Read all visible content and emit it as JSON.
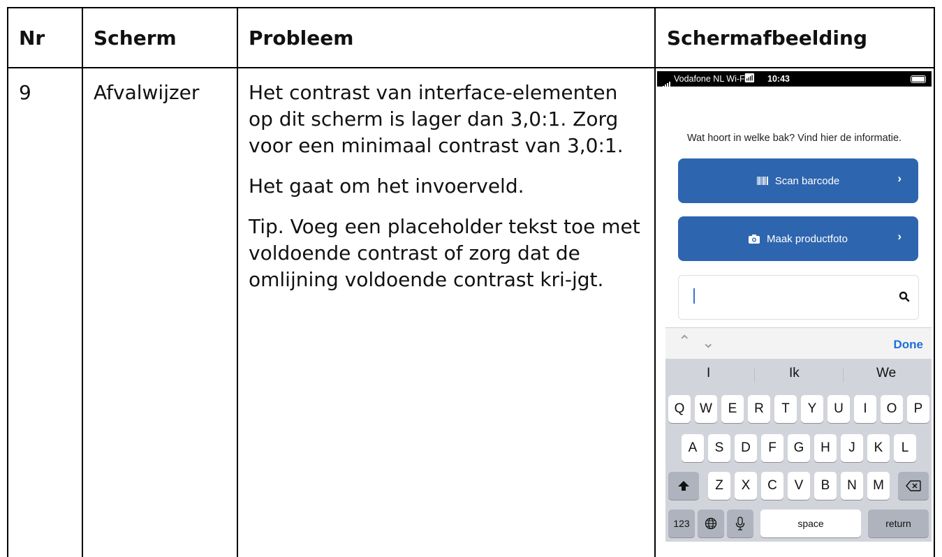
{
  "table": {
    "headers": {
      "nr": "Nr",
      "screen": "Scherm",
      "problem": "Probleem",
      "screenshot": "Schermafbeelding"
    },
    "row": {
      "nr": "9",
      "screen": "Afvalwijzer",
      "problem_paragraphs": [
        "Het contrast van interface-elementen op dit scherm is lager dan 3,0:1. Zorg voor een minimaal contrast van 3,0:1.",
        "Het gaat om het invoerveld.",
        "Tip. Voeg een placeholder tekst toe met voldoende contrast of zorg dat de omlijning voldoende contrast kri-jgt."
      ]
    }
  },
  "phone": {
    "status_bar": {
      "carrier": "Vodafone NL Wi-Fi",
      "time": "10:43"
    },
    "intro": "Wat hoort in welke bak? Vind hier de informatie.",
    "scan_button": "Scan barcode",
    "photo_button": "Maak productfoto",
    "search_value": "",
    "keyboard": {
      "done": "Done",
      "suggestions": [
        "I",
        "Ik",
        "We"
      ],
      "row1": [
        "Q",
        "W",
        "E",
        "R",
        "T",
        "Y",
        "U",
        "I",
        "O",
        "P"
      ],
      "row2": [
        "A",
        "S",
        "D",
        "F",
        "G",
        "H",
        "J",
        "K",
        "L"
      ],
      "row3": [
        "Z",
        "X",
        "C",
        "V",
        "B",
        "N",
        "M"
      ],
      "numbers_key": "123",
      "space_key": "space",
      "return_key": "return"
    },
    "colors": {
      "button": "#2E65AF",
      "done": "#1d6fd8",
      "keyboard_bg": "#d1d4da"
    }
  }
}
